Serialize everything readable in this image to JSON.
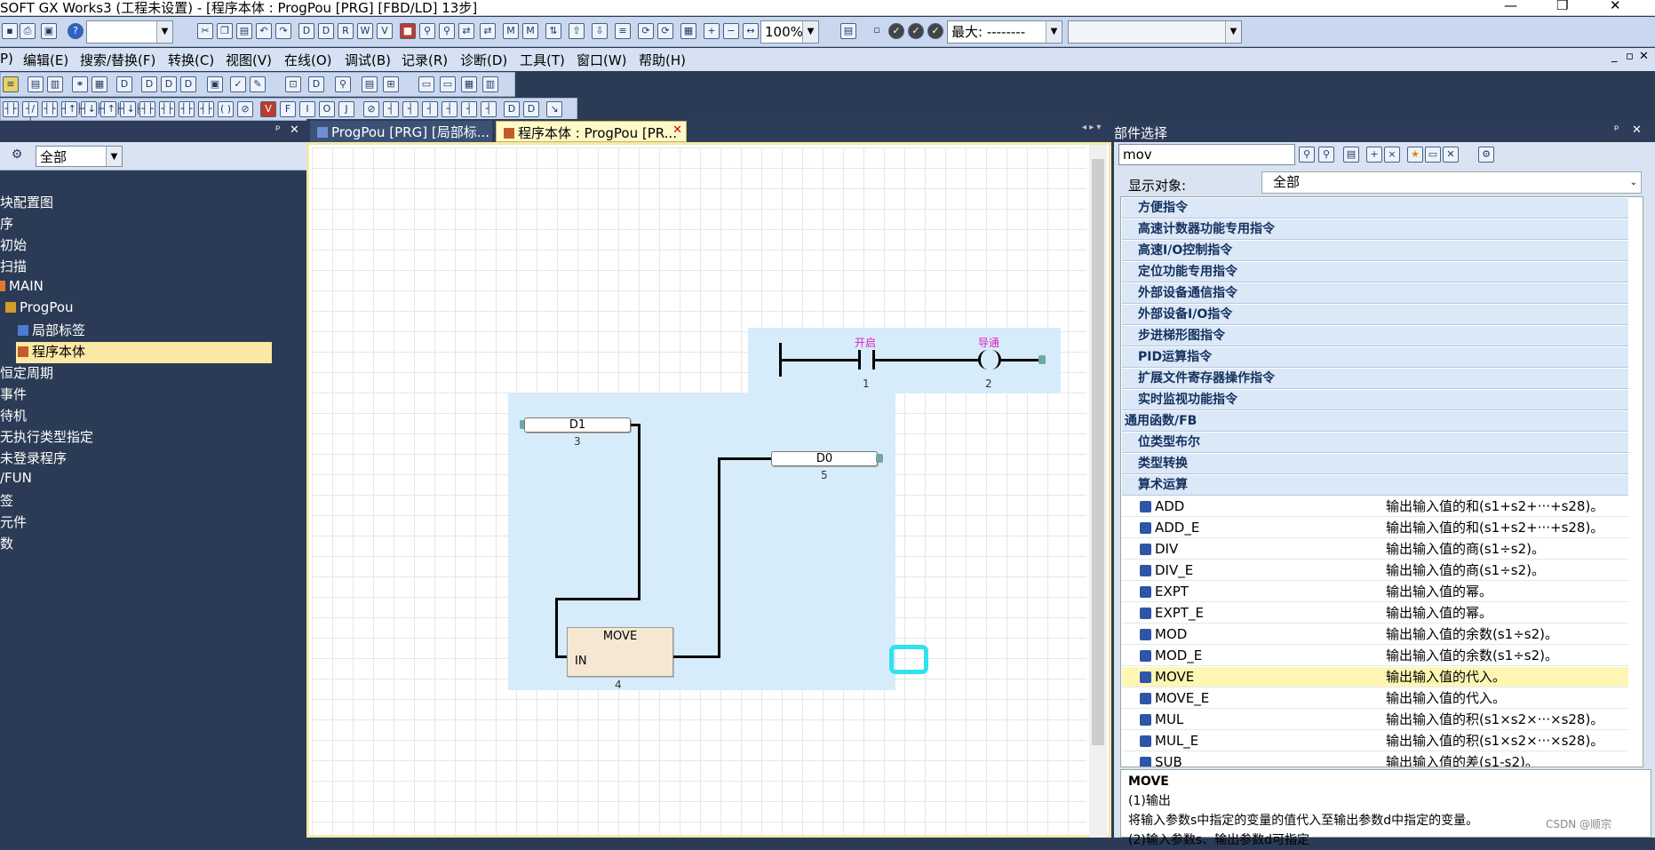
{
  "titlebar": {
    "title": "SOFT GX Works3 (工程未设置) - [程序本体 : ProgPou [PRG] [FBD/LD] 13步]",
    "min": "—",
    "restore": "❐",
    "close": "✕"
  },
  "toolbar1": {
    "combo1": "",
    "zoom": "100%",
    "max_label": "最大: --------",
    "combo_last": ""
  },
  "menu": {
    "items": [
      "P)",
      "编辑(E)",
      "搜索/替换(F)",
      "转换(C)",
      "视图(V)",
      "在线(O)",
      "调试(B)",
      "记录(R)",
      "诊断(D)",
      "工具(T)",
      "窗口(W)",
      "帮助(H)"
    ],
    "right": [
      "_",
      "▫",
      "✕"
    ]
  },
  "left_pane": {
    "pin": "ᵖ",
    "close": "✕",
    "filter": "全部",
    "tree": [
      {
        "label": "块配置图"
      },
      {
        "label": "序"
      },
      {
        "label": "初始"
      },
      {
        "label": "扫描"
      },
      {
        "label": "MAIN"
      },
      {
        "label": "ProgPou"
      },
      {
        "label": "局部标签"
      },
      {
        "label": "程序本体"
      },
      {
        "label": "恒定周期"
      },
      {
        "label": "事件"
      },
      {
        "label": "待机"
      },
      {
        "label": "无执行类型指定"
      },
      {
        "label": "未登录程序"
      },
      {
        "label": "/FUN"
      },
      {
        "label": "签"
      },
      {
        "label": "元件"
      },
      {
        "label": "数"
      }
    ]
  },
  "editor": {
    "tabs": [
      {
        "label": "ProgPou [PRG] [局部标..."
      },
      {
        "label": "程序本体 : ProgPou [PR..."
      }
    ],
    "tab_close": "✕",
    "contact_label": "开启",
    "coil_label": "导通",
    "node_contact": "1",
    "node_coil": "2",
    "var_in": "D1",
    "var_in_num": "3",
    "var_out": "D0",
    "var_out_num": "5",
    "fb_name": "MOVE",
    "fb_pin": "IN",
    "fb_num": "4"
  },
  "right_pane": {
    "title": "部件选择",
    "pin": "ᵖ",
    "close": "✕",
    "search_value": "mov",
    "display_label": "显示对象:",
    "display_value": "全部",
    "categories": [
      "方便指令",
      "高速计数器功能专用指令",
      "高速I/O控制指令",
      "定位功能专用指令",
      "外部设备通信指令",
      "外部设备I/O指令",
      "步进梯形图指令",
      "PID运算指令",
      "扩展文件寄存器操作指令",
      "实时监视功能指令",
      "通用函数/FB",
      "位类型布尔",
      "类型转换",
      "算术运算"
    ],
    "rows": [
      {
        "name": "ADD",
        "desc": "输出输入值的和(s1+s2+···+s28)。"
      },
      {
        "name": "ADD_E",
        "desc": "输出输入值的和(s1+s2+···+s28)。"
      },
      {
        "name": "DIV",
        "desc": "输出输入值的商(s1÷s2)。"
      },
      {
        "name": "DIV_E",
        "desc": "输出输入值的商(s1÷s2)。"
      },
      {
        "name": "EXPT",
        "desc": "输出输入值的幂。"
      },
      {
        "name": "EXPT_E",
        "desc": "输出输入值的幂。"
      },
      {
        "name": "MOD",
        "desc": "输出输入值的余数(s1÷s2)。"
      },
      {
        "name": "MOD_E",
        "desc": "输出输入值的余数(s1÷s2)。"
      },
      {
        "name": "MOVE",
        "desc": "输出输入值的代入。"
      },
      {
        "name": "MOVE_E",
        "desc": "输出输入值的代入。"
      },
      {
        "name": "MUL",
        "desc": "输出输入值的积(s1×s2×···×s28)。"
      },
      {
        "name": "MUL_E",
        "desc": "输出输入值的积(s1×s2×···×s28)。"
      },
      {
        "name": "SUB",
        "desc": "输出输入值的差(s1-s2)。"
      }
    ],
    "selected": "MOVE",
    "description": {
      "title": "MOVE",
      "line1": "(1)输出",
      "line2": "将输入参数s中指定的变量的值代入至输出参数d中指定的变量。",
      "line3": "(2)输入参数s、输出参数d可指定"
    }
  },
  "watermark": "CSDN @顺宗",
  "colors": {
    "accent_selection": "#d7ecfb",
    "highlight": "#fff6b4",
    "cursor": "#30e2f0",
    "pane_dark": "#2b3b55"
  }
}
